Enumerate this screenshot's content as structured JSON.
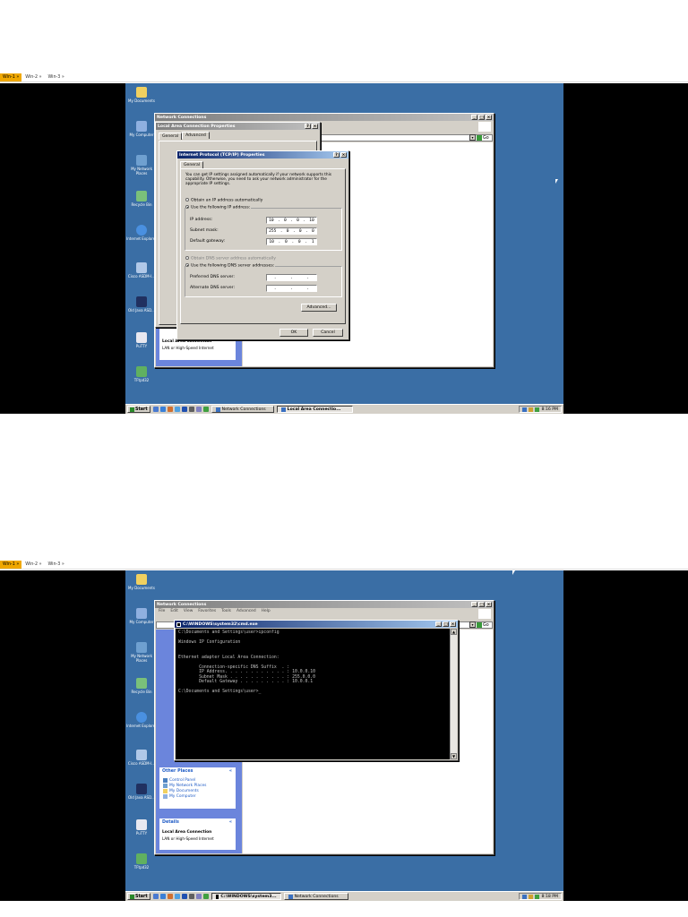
{
  "kvm_tabs": [
    "Win-1 »",
    "Win-2 »",
    "Win-3 »"
  ],
  "desktop_icons": [
    "My Documents",
    "My Computer",
    "My Network Places",
    "Recycle Bin",
    "Internet Explorer",
    "Cisco ASDM-I...",
    "Old Java ASD...",
    "PuTTY",
    "TFtpd32"
  ],
  "shot1": {
    "network_connections_title": "Network Connections",
    "lac_properties_title": "Local Area Connection Properties",
    "lac_tabs": [
      "General",
      "Advanced"
    ],
    "tcpip_title": "Internet Protocol (TCP/IP) Properties",
    "tcpip_tab": "General",
    "intro_text": "You can get IP settings assigned automatically if your network supports this capability. Otherwise, you need to ask your network administrator for the appropriate IP settings.",
    "radio_auto_ip": "Obtain an IP address automatically",
    "radio_use_ip": "Use the following IP address:",
    "ip_label": "IP address:",
    "ip_value": [
      "10",
      "0",
      "0",
      "10"
    ],
    "mask_label": "Subnet mask:",
    "mask_value": [
      "255",
      "0",
      "0",
      "0"
    ],
    "gw_label": "Default gateway:",
    "gw_value": [
      "10",
      "0",
      "0",
      "1"
    ],
    "radio_auto_dns": "Obtain DNS server address automatically",
    "radio_use_dns": "Use the following DNS server addresses:",
    "pref_dns_label": "Preferred DNS server:",
    "alt_dns_label": "Alternate DNS server:",
    "advanced_btn": "Advanced...",
    "ok_btn": "OK",
    "cancel_btn": "Cancel",
    "go_btn": "Go",
    "details_head": "Details",
    "details_title": "Local Area Connection",
    "details_sub": "LAN or High-Speed Internet",
    "taskbar_items": [
      "Network Connections",
      "Local Area Connectio..."
    ],
    "clock": "8:16 PM"
  },
  "shot2": {
    "network_connections_title": "Network Connections",
    "menu": [
      "File",
      "Edit",
      "View",
      "Favorites",
      "Tools",
      "Advanced",
      "Help"
    ],
    "cmd_title": "C:\\WINDOWS\\system32\\cmd.exe",
    "console_lines": [
      "C:\\Documents and Settings\\user>ipconfig",
      "",
      "Windows IP Configuration",
      "",
      "",
      "Ethernet adapter Local Area Connection:",
      "",
      "        Connection-specific DNS Suffix  . :",
      "        IP Address. . . . . . . . . . . . : 10.0.0.10",
      "        Subnet Mask . . . . . . . . . . . : 255.0.0.0",
      "        Default Gateway . . . . . . . . . : 10.0.0.1",
      "",
      "C:\\Documents and Settings\\user>_"
    ],
    "other_places_head": "Other Places",
    "other_places": [
      "Control Panel",
      "My Network Places",
      "My Documents",
      "My Computer"
    ],
    "details_head": "Details",
    "details_title": "Local Area Connection",
    "details_sub": "LAN or High-Speed Internet",
    "go_btn": "Go",
    "taskbar_items": [
      "C:\\WINDOWS\\system3...",
      "Network Connections"
    ],
    "clock": "8:18 PM"
  },
  "start_label": "Start",
  "colors": {
    "desktop": "#3a6ea5",
    "kvm_active": "#f0a800",
    "title_active": "#0a246a"
  }
}
